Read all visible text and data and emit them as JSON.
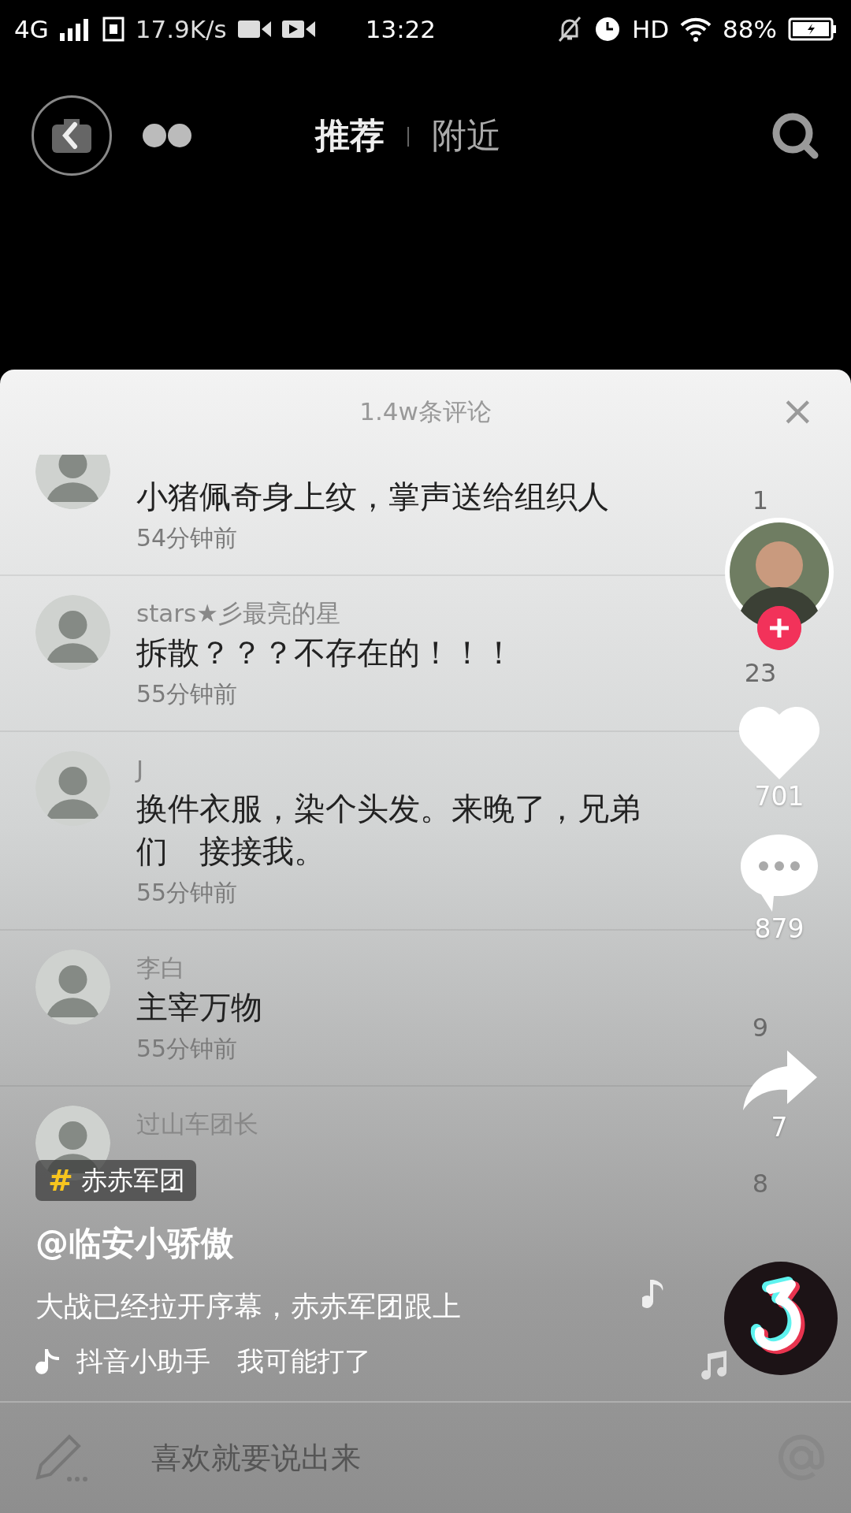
{
  "status_bar": {
    "network": "4G",
    "speed": "17.9K/s",
    "time": "13:22",
    "hd": "HD",
    "battery": "88%"
  },
  "nav": {
    "tabs": [
      {
        "label": "推荐",
        "selected": true
      },
      {
        "label": "附近",
        "selected": false
      }
    ],
    "divider": "|"
  },
  "comments": {
    "title": "1.4w条评论",
    "close": "×",
    "items": [
      {
        "text": "小猪佩奇身上纹，掌声送给组织人",
        "time": "54分钟前",
        "likes": "1"
      },
      {
        "user": "stars★彡最亮的星",
        "text": "拆散？？？不存在的！！！",
        "time": "55分钟前",
        "likes": "23"
      },
      {
        "user": "J",
        "text": "换件衣服，染个头发。来晚了，兄弟们　接接我。",
        "time": "55分钟前"
      },
      {
        "user": "李白",
        "text": "主宰万物",
        "time": "55分钟前",
        "likes": "9"
      },
      {
        "user": "过山车团长",
        "likes": "8"
      }
    ],
    "input": {
      "placeholder": "喜欢就要说出来"
    }
  },
  "video": {
    "likes": "701",
    "comment_count": "879",
    "shares": "7",
    "hashtag": {
      "symbol": "#",
      "label": "赤赤军团"
    },
    "author": "@临安小骄傲",
    "description": "大战已经拉开序幕，赤赤军团跟上",
    "music": "抖音小助手　我可能打了"
  }
}
